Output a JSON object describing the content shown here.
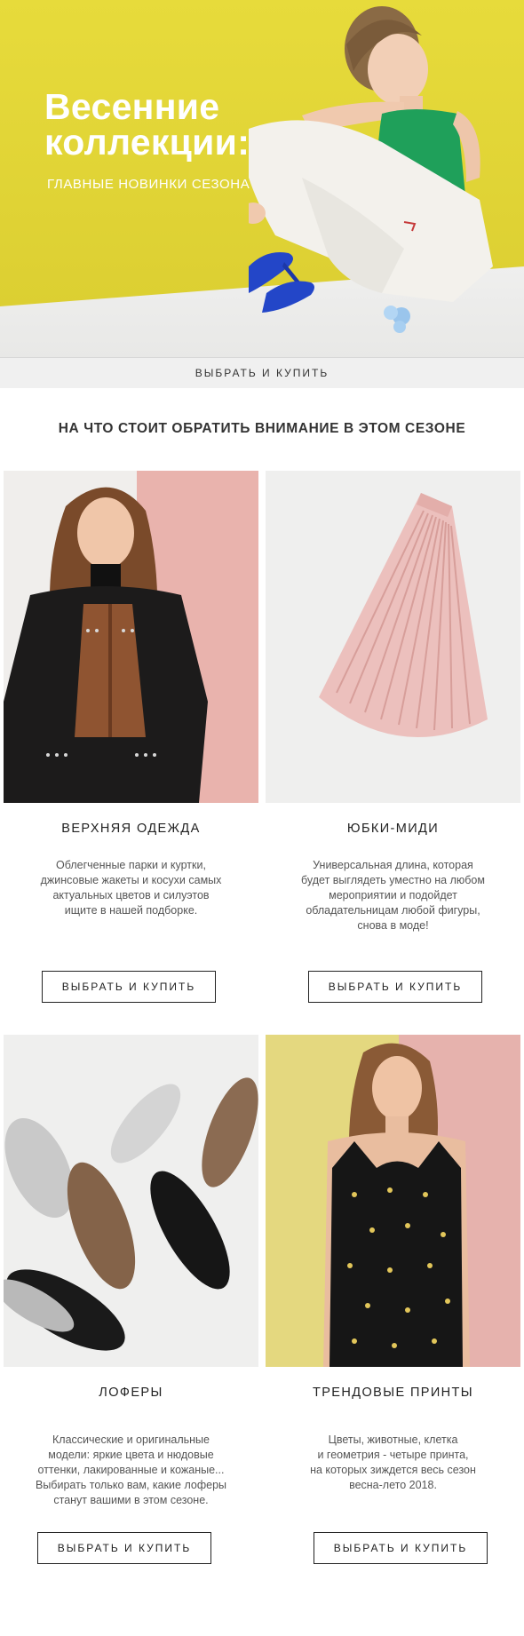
{
  "hero": {
    "title_line1": "Весенние",
    "title_line2": "коллекции:",
    "subtitle": "ГЛАВНЫЕ НОВИНКИ СЕЗОНА",
    "button_label": "ВЫБРАТЬ И КУПИТЬ"
  },
  "section_title": "НА ЧТО СТОИТ ОБРАТИТЬ ВНИМАНИЕ В ЭТОМ СЕЗОНЕ",
  "cards": [
    {
      "title": "ВЕРХНЯЯ ОДЕЖДА",
      "desc": [
        "Облегченные парки и куртки,",
        "джинсовые жакеты и косухи самых",
        "актуальных цветов и силуэтов",
        "ищите в нашей подборке."
      ],
      "button_label": "ВЫБРАТЬ И КУПИТЬ"
    },
    {
      "title": "ЮБКИ-МИДИ",
      "desc": [
        "Универсальная длина, которая",
        "будет выглядеть уместно на любом",
        "мероприятии и подойдет",
        "обладательницам любой фигуры,",
        "снова в моде!"
      ],
      "button_label": "ВЫБРАТЬ И КУПИТЬ"
    },
    {
      "title": "ЛОФЕРЫ",
      "desc": [
        "Классические и оригинальные",
        "модели: яркие цвета и нюдовые",
        "оттенки, лакированные и кожаные...",
        "Выбирать только вам, какие лоферы",
        "станут вашими в этом сезоне."
      ],
      "button_label": "ВЫБРАТЬ И КУПИТЬ"
    },
    {
      "title": "ТРЕНДОВЫЕ ПРИНТЫ",
      "desc": [
        "Цветы, животные, клетка",
        "и геометрия - четыре принта,",
        "на которых зиждется весь сезон",
        "весна-лето 2018."
      ],
      "button_label": "ВЫБРАТЬ И КУПИТЬ"
    }
  ],
  "colors": {
    "hero_yellow": "#e2d536",
    "accent_green": "#1fa05a",
    "accent_blue": "#2346c8",
    "pink_bg": "#e9b9b4"
  }
}
